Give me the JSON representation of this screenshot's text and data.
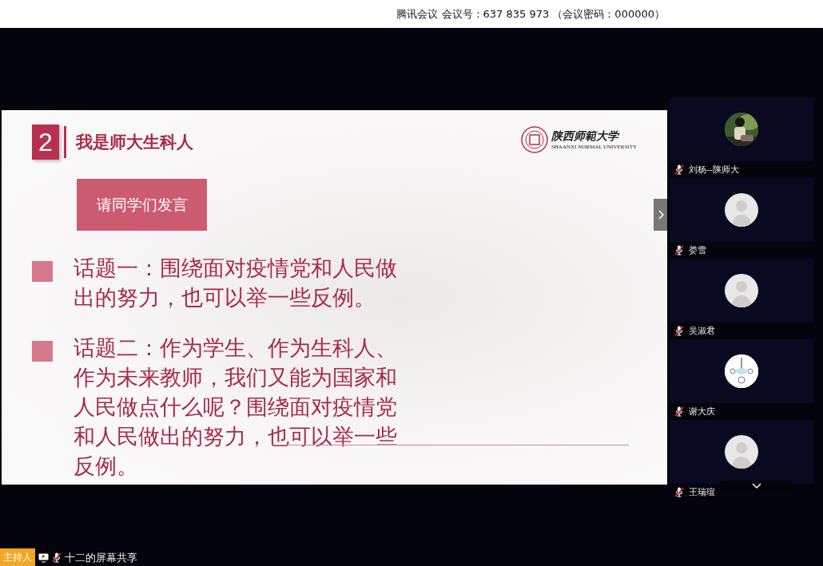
{
  "header": {
    "title": "腾讯会议 会议号：637 835 973 （会议密码：000000）"
  },
  "slide": {
    "number": "2",
    "heading": "我是师大生科人",
    "logo": {
      "name_cn": "陕西师範大学",
      "name_en": "SHAANXI NORMAL UNIVERSITY"
    },
    "call_to_action": "请同学们发言",
    "topics": [
      {
        "text": "话题一：围绕面对疫情党和人民做出的努力，也可以举一些反例。"
      },
      {
        "text": "话题二：作为学生、作为生科人、作为未来教师，我们又能为国家和人民做点什么呢？围绕面对疫情党和人民做出的努力，也可以举一些反例。"
      }
    ]
  },
  "participants": [
    {
      "name": "刘杨--陕师大",
      "muted": true
    },
    {
      "name": "娄雪",
      "kind": "default",
      "muted": true
    },
    {
      "name": "吴淑君",
      "kind": "default",
      "muted": true
    },
    {
      "name": "谢大庆",
      "kind": "diagram",
      "muted": true
    },
    {
      "name": "王瑞瑄",
      "kind": "default",
      "muted": true
    }
  ],
  "status_bar": {
    "role_badge": "主持人",
    "sharer": "十二的屏幕共享",
    "muted": true
  }
}
